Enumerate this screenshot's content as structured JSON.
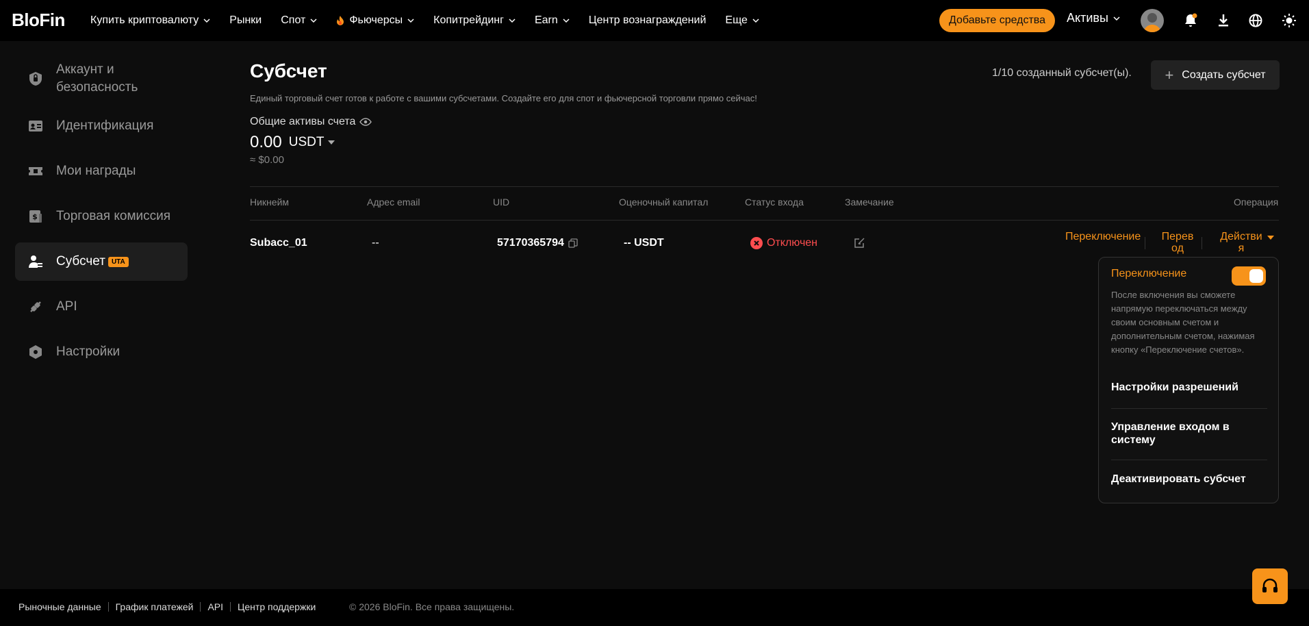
{
  "brand": {
    "logo": "BloFin",
    "accent": "#f7931a",
    "danger": "#ff4d4f"
  },
  "nav": {
    "items": [
      {
        "label": "Купить криптовалюту",
        "dropdown": true
      },
      {
        "label": "Рынки",
        "dropdown": false
      },
      {
        "label": "Спот",
        "dropdown": true
      },
      {
        "label": "Фьючерсы",
        "dropdown": true,
        "icon": "fire-icon"
      },
      {
        "label": "Копитрейдинг",
        "dropdown": true
      },
      {
        "label": "Earn",
        "dropdown": true
      },
      {
        "label": "Центр вознаграждений",
        "dropdown": false
      },
      {
        "label": "Еще",
        "dropdown": true
      }
    ],
    "deposit_label": "Добавьте средства",
    "assets_label": "Активы"
  },
  "sidebar": {
    "items": [
      {
        "label": "Аккаунт и безопасность",
        "icon": "shield-icon"
      },
      {
        "label": "Идентификация",
        "icon": "id-card-icon"
      },
      {
        "label": "Мои награды",
        "icon": "ticket-icon"
      },
      {
        "label": "Торговая комиссия",
        "icon": "fee-icon"
      },
      {
        "label": "Субсчет",
        "icon": "subaccount-icon",
        "badge": "UTA",
        "active": true
      },
      {
        "label": "API",
        "icon": "api-icon"
      },
      {
        "label": "Настройки",
        "icon": "settings-icon"
      }
    ]
  },
  "main": {
    "title": "Субсчет",
    "subaccount_count": "1/10 созданный субсчет(ы).",
    "create_label": "Создать субсчет",
    "description": "Единый торговый счет готов к работе с вашими субсчетами. Создайте его для спот и фьючерсной торговли прямо сейчас!",
    "assets_label": "Общие активы счета",
    "balance": "0.00",
    "currency": "USDT",
    "usd_value": "≈ $0.00"
  },
  "table": {
    "headers": {
      "nickname": "Никнейм",
      "email": "Адрес email",
      "uid": "UID",
      "equity": "Оценочный капитал",
      "login_status": "Статус входа",
      "note": "Замечание",
      "operation": "Операция"
    },
    "rows": [
      {
        "nickname": "Subacc_01",
        "email": "--",
        "uid": "57170365794",
        "equity": "-- USDT",
        "status": "Отключен",
        "op_switch": "Переключение",
        "op_transfer": "Перевод",
        "op_actions": "Действия"
      }
    ]
  },
  "dropdown": {
    "title": "Переключение",
    "toggle_on": true,
    "description": "После включения вы сможете напрямую переключаться между своим основным счетом и дополнительным счетом, нажимая кнопку «Переключение счетов».",
    "items": [
      "Настройки разрешений",
      "Управление входом в систему",
      "Деактивировать субсчет"
    ]
  },
  "footer": {
    "links": [
      "Рыночные данные",
      "График платежей",
      "API",
      "Центр поддержки"
    ],
    "copyright": "© 2026 BloFin. Все права защищены."
  }
}
